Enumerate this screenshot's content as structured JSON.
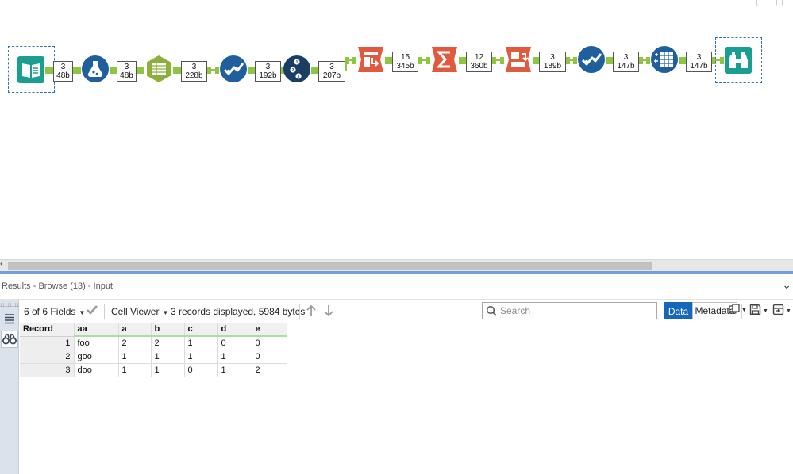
{
  "canvas": {
    "tools": [
      {
        "name": "input-data-tool",
        "icon": "book-icon",
        "color": "#1a9e8f"
      },
      {
        "name": "formula-tool",
        "icon": "flask-icon",
        "color": "#1f5f9e"
      },
      {
        "name": "text-to-columns-tool",
        "icon": "table-columns-icon",
        "color": "#8db03a"
      },
      {
        "name": "select-tool",
        "icon": "checkmark-icon",
        "color": "#1f5f9e"
      },
      {
        "name": "record-id-tool",
        "icon": "numbered-list-icon",
        "color": "#1a3d66"
      },
      {
        "name": "transpose-tool",
        "icon": "transpose-icon",
        "color": "#e05a3e"
      },
      {
        "name": "summarize-tool",
        "icon": "sigma-icon",
        "color": "#e05a3e"
      },
      {
        "name": "cross-tab-tool",
        "icon": "crosstab-icon",
        "color": "#e05a3e"
      },
      {
        "name": "select-tool-2",
        "icon": "checkmark-icon",
        "color": "#1f5f9e"
      },
      {
        "name": "multi-field-formula-tool",
        "icon": "multi-field-icon",
        "color": "#1f5f9e"
      },
      {
        "name": "browse-tool",
        "icon": "binoculars-icon",
        "color": "#1a9e8f"
      }
    ],
    "badges": [
      {
        "count": "3",
        "size": "48b"
      },
      {
        "count": "3",
        "size": "48b"
      },
      {
        "count": "3",
        "size": "228b"
      },
      {
        "count": "3",
        "size": "192b"
      },
      {
        "count": "3",
        "size": "207b"
      },
      {
        "count": "15",
        "size": "345b"
      },
      {
        "count": "12",
        "size": "360b"
      },
      {
        "count": "3",
        "size": "189b"
      },
      {
        "count": "3",
        "size": "147b"
      },
      {
        "count": "3",
        "size": "147b"
      }
    ],
    "wire_color": "#8dc63f"
  },
  "results": {
    "title": "Results - Browse (13) - Input",
    "toolbar": {
      "fields_label": "6 of 6 Fields",
      "cell_viewer_label": "Cell Viewer",
      "records_info": "3 records displayed, 5984 bytes",
      "search_placeholder": "Search",
      "data_tab": "Data",
      "metadata_tab": "Metadata"
    },
    "columns": [
      "Record",
      "aa",
      "a",
      "b",
      "c",
      "d",
      "e"
    ],
    "rows": [
      [
        "1",
        "foo",
        "2",
        "2",
        "1",
        "0",
        "0"
      ],
      [
        "2",
        "goo",
        "1",
        "1",
        "1",
        "1",
        "0"
      ],
      [
        "3",
        "doo",
        "1",
        "1",
        "0",
        "1",
        "2"
      ]
    ]
  },
  "colors": {
    "accent": "#1467bb",
    "teal": "#1a9e8f",
    "navy": "#1f5f9e",
    "orange": "#e05a3e",
    "green": "#8db03a"
  }
}
